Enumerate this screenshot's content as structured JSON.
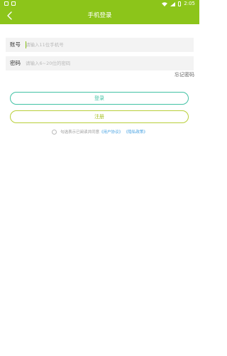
{
  "status_bar": {
    "time": "2:05"
  },
  "header": {
    "title": "手机登录"
  },
  "form": {
    "account_label": "账号",
    "account_placeholder": "请输入11位手机号",
    "password_label": "密码",
    "password_placeholder": "请输入6~20位的密码",
    "forgot_label": "忘记密码"
  },
  "buttons": {
    "login": "登录",
    "register": "注册"
  },
  "agreement": {
    "text": "勾选表示已阅读并同意",
    "user_agreement": "《用户协议》",
    "privacy_policy": "《隐私政策》"
  },
  "colors": {
    "header_bg": "#8cc51a",
    "login_border": "#42c2a4",
    "register_border": "#b9cf3a",
    "link": "#4aa3e2"
  }
}
